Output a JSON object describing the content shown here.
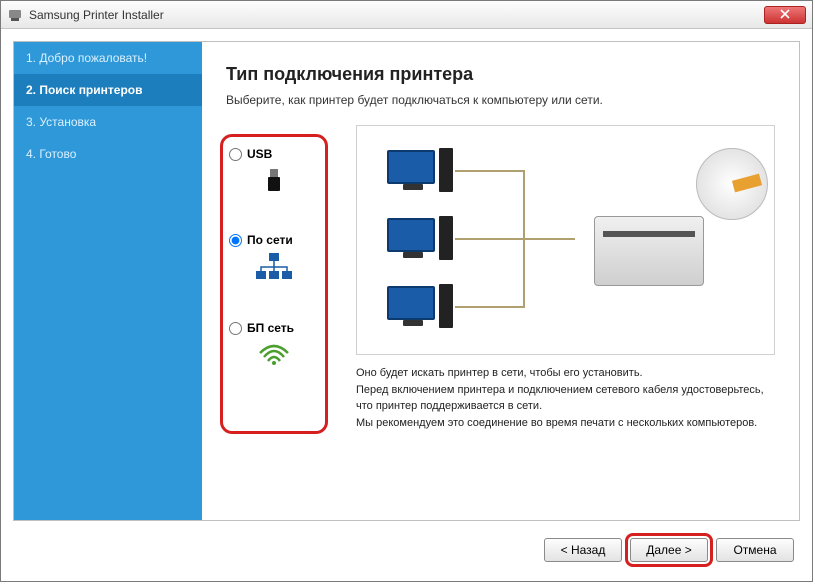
{
  "window": {
    "title": "Samsung Printer Installer"
  },
  "sidebar": {
    "steps": [
      {
        "label": "1. Добро пожаловать!"
      },
      {
        "label": "2. Поиск принтеров"
      },
      {
        "label": "3. Установка"
      },
      {
        "label": "4. Готово"
      }
    ],
    "active_index": 1
  },
  "main": {
    "heading": "Тип подключения принтера",
    "subtitle": "Выберите, как принтер будет подключаться к компьютеру или сети.",
    "options": {
      "usb": {
        "label": "USB",
        "selected": false
      },
      "network": {
        "label": "По сети",
        "selected": true
      },
      "wireless": {
        "label": "БП сеть",
        "selected": false
      }
    },
    "description": "Оно будет искать принтер в сети, чтобы его установить.\nПеред включением принтера и подключением сетевого кабеля удостоверьтесь, что принтер поддерживается в сети.\nМы рекомендуем это соединение во время печати с нескольких компьютеров."
  },
  "buttons": {
    "back": "< Назад",
    "next": "Далее >",
    "cancel": "Отмена"
  }
}
